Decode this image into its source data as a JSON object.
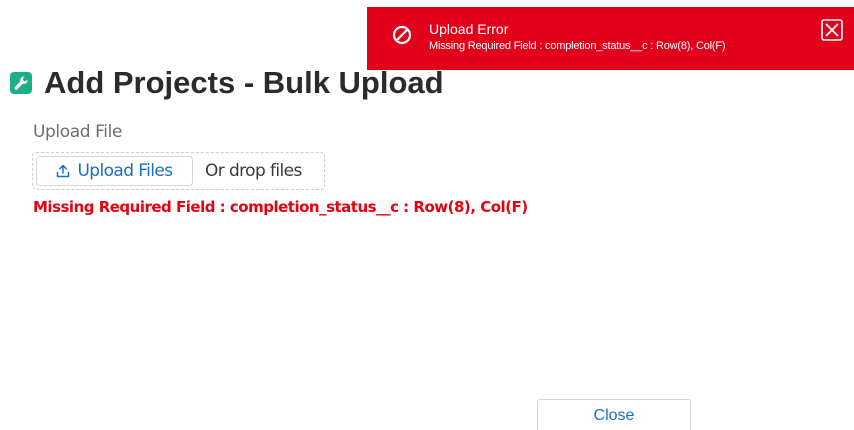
{
  "toast": {
    "title": "Upload Error",
    "message": "Missing Required Field : completion_status__c : Row(8), Col(F)",
    "icon": "error-circle-slash-icon",
    "close_icon": "close-icon",
    "color": "#e3001b"
  },
  "header": {
    "icon": "wrench-icon",
    "icon_color": "#1fae8c",
    "title": "Add Projects - Bulk Upload"
  },
  "upload": {
    "label": "Upload File",
    "button_label": "Upload Files",
    "button_icon": "upload-icon",
    "drop_text": "Or drop files",
    "error": "Missing Required Field : completion_status__c : Row(8), Col(F)"
  },
  "footer": {
    "close_label": "Close"
  }
}
